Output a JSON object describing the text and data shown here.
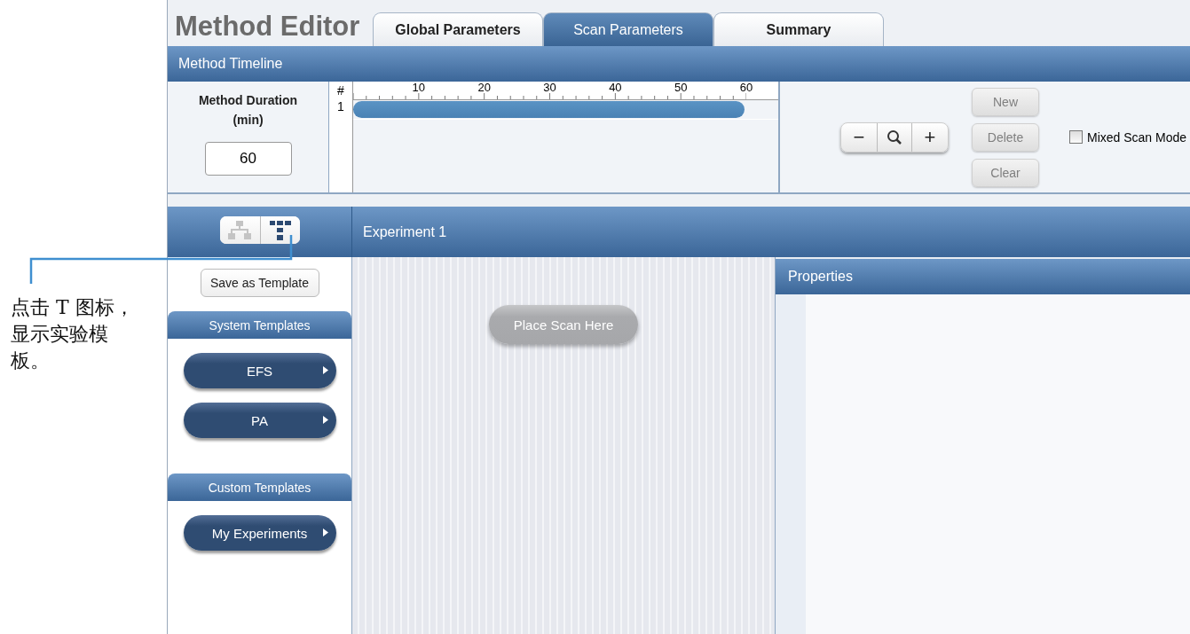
{
  "annotation": {
    "text": "点击 T 图标，显示实验模板。"
  },
  "title": "Method Editor",
  "tabs": [
    {
      "label": "Global Parameters",
      "selected": false
    },
    {
      "label": "Scan Parameters",
      "selected": true
    },
    {
      "label": "Summary",
      "selected": false
    }
  ],
  "timeline": {
    "title": "Method Timeline",
    "duration_label": "Method Duration (min)",
    "duration_value": "60",
    "row_header": "#",
    "ticks": [
      "10",
      "20",
      "30",
      "40",
      "50",
      "60"
    ],
    "rows": [
      {
        "number": "1",
        "level": 0.92
      }
    ]
  },
  "zoom": {
    "minus": "−",
    "plus": "+"
  },
  "buttons": [
    {
      "label": "New",
      "disabled": true
    },
    {
      "label": "Delete",
      "disabled": true
    },
    {
      "label": "Clear",
      "disabled": true
    }
  ],
  "mixed_scan_mode": {
    "label": "Mixed Scan Mode",
    "checked": false
  },
  "view_toggle": [
    {
      "kind": "tree",
      "selected": false
    },
    {
      "kind": "template",
      "selected": true
    }
  ],
  "experiment": {
    "title": "Experiment 1",
    "save_button": "Save as Template",
    "placeholder": "Place Scan Here"
  },
  "template_sections": [
    {
      "title": "System Templates",
      "items": [
        "EFS",
        "PA"
      ]
    },
    {
      "title": "Custom Templates",
      "items": [
        "My Experiments"
      ]
    }
  ],
  "properties": {
    "title": "Properties"
  }
}
